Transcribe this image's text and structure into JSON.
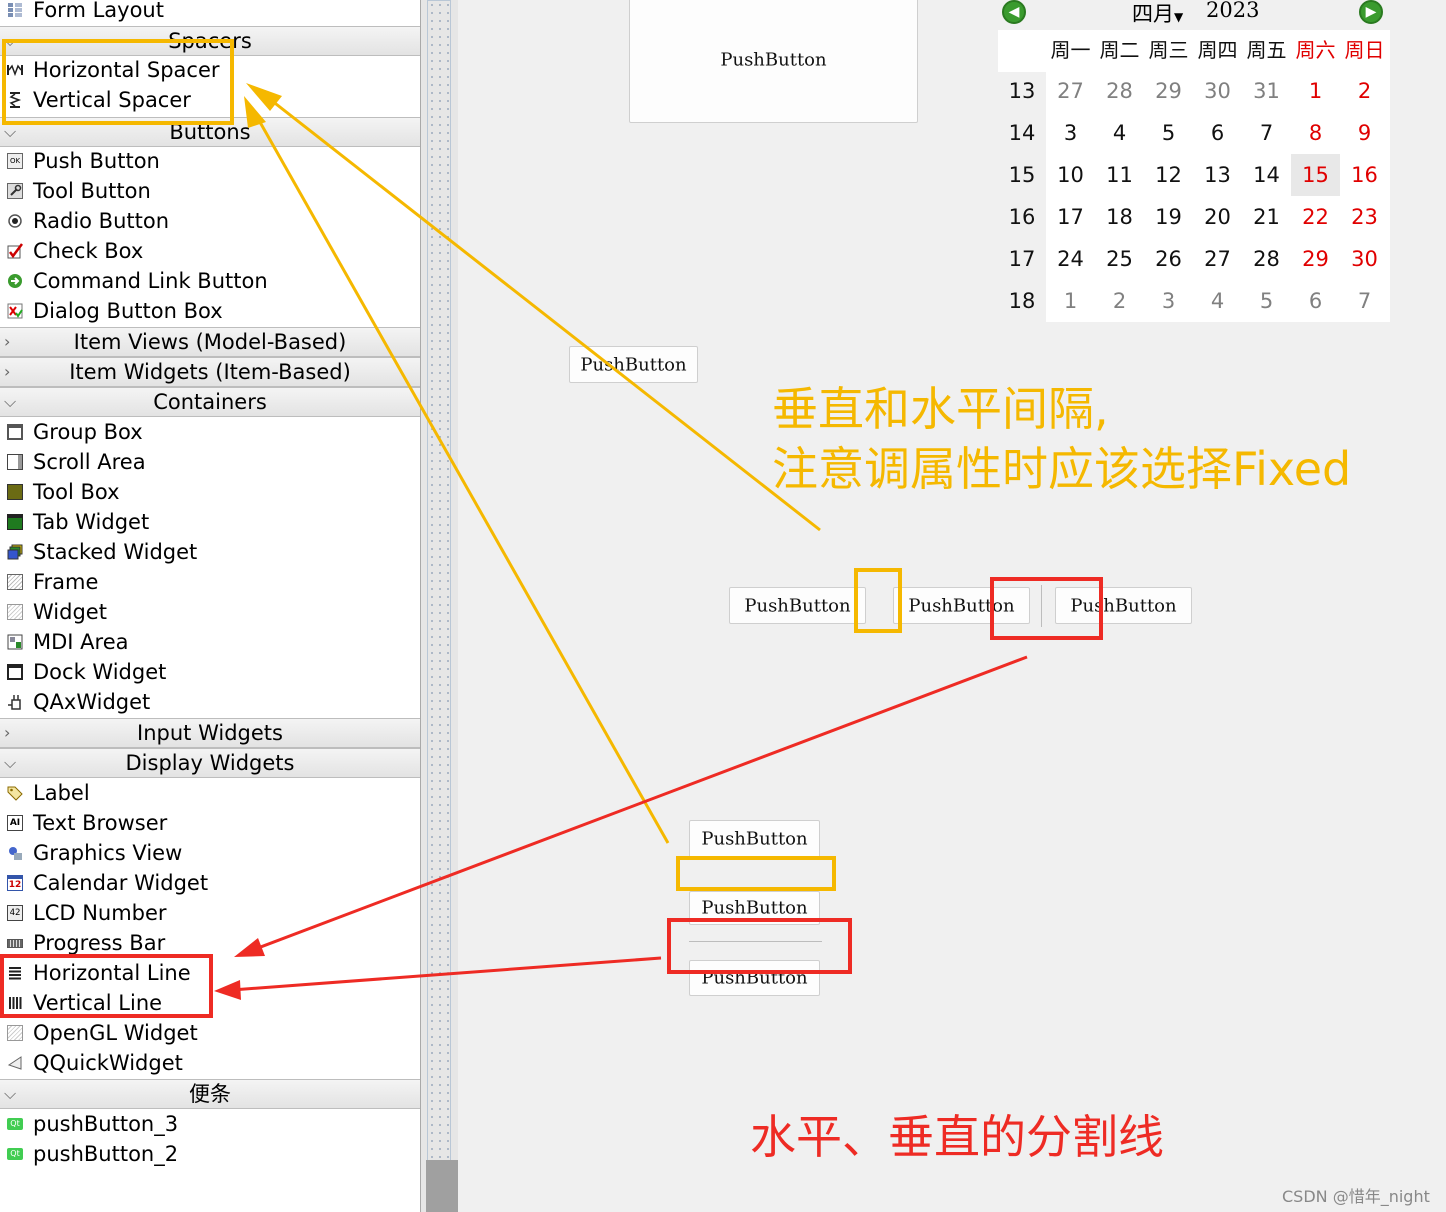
{
  "panel": {
    "top_header": "Form Layout",
    "spacers": {
      "header": "Spacers",
      "items": [
        "Horizontal Spacer",
        "Vertical Spacer"
      ]
    },
    "buttons": {
      "header": "Buttons",
      "items": [
        "Push Button",
        "Tool Button",
        "Radio Button",
        "Check Box",
        "Command Link Button",
        "Dialog Button Box"
      ]
    },
    "collapsed1": "Item Views (Model-Based)",
    "collapsed2": "Item Widgets (Item-Based)",
    "containers": {
      "header": "Containers",
      "items": [
        "Group Box",
        "Scroll Area",
        "Tool Box",
        "Tab Widget",
        "Stacked Widget",
        "Frame",
        "Widget",
        "MDI Area",
        "Dock Widget",
        "QAxWidget"
      ]
    },
    "collapsed3": "Input Widgets",
    "display": {
      "header": "Display Widgets",
      "items": [
        "Label",
        "Text Browser",
        "Graphics View",
        "Calendar Widget",
        "LCD Number",
        "Progress Bar",
        "Horizontal Line",
        "Vertical Line",
        "OpenGL Widget",
        "QQuickWidget"
      ]
    },
    "scratchpad": {
      "header": "便条",
      "items": [
        "pushButton_3",
        "pushButton_2"
      ]
    }
  },
  "canvas": {
    "button_label": "PushButton",
    "note_spacer_line1": "垂直和水平间隔,",
    "note_spacer_line2": "注意调属性时应该选择Fixed",
    "note_lines": "水平、垂直的分割线",
    "watermark": "CSDN @惜年_night"
  },
  "calendar": {
    "month": "四月",
    "year": "2023",
    "weekdays": [
      "周一",
      "周二",
      "周三",
      "周四",
      "周五",
      "周六",
      "周日"
    ],
    "weeks": [
      {
        "wk": "13",
        "days": [
          "27",
          "28",
          "29",
          "30",
          "31",
          "1",
          "2"
        ]
      },
      {
        "wk": "14",
        "days": [
          "3",
          "4",
          "5",
          "6",
          "7",
          "8",
          "9"
        ]
      },
      {
        "wk": "15",
        "days": [
          "10",
          "11",
          "12",
          "13",
          "14",
          "15",
          "16"
        ]
      },
      {
        "wk": "16",
        "days": [
          "17",
          "18",
          "19",
          "20",
          "21",
          "22",
          "23"
        ]
      },
      {
        "wk": "17",
        "days": [
          "24",
          "25",
          "26",
          "27",
          "28",
          "29",
          "30"
        ]
      },
      {
        "wk": "18",
        "days": [
          "1",
          "2",
          "3",
          "4",
          "5",
          "6",
          "7"
        ]
      }
    ]
  },
  "colors": {
    "annotation_orange": "#f5b800",
    "annotation_red": "#ee2b24",
    "weekend_red": "#e00000",
    "muted_day": "#808080"
  }
}
